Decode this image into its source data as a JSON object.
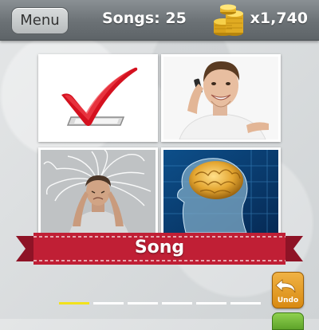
{
  "header": {
    "menu_label": "Menu",
    "songs_label": "Songs:  25",
    "coins_value": "x1,740",
    "coins_icon": "gold-coins-icon"
  },
  "puzzle": {
    "tiles": [
      {
        "name": "checkmark-picture"
      },
      {
        "name": "man-on-phone-picture"
      },
      {
        "name": "stressed-man-picture"
      },
      {
        "name": "brain-picture"
      }
    ],
    "banner_label": "Song"
  },
  "answer": {
    "slot_count": 6,
    "filled_slots": 1
  },
  "controls": {
    "undo_label": "Undo",
    "undo_icon": "undo-arrow-icon"
  },
  "colors": {
    "topbar": "#6b7175",
    "banner": "#c01f35",
    "slot_filled": "#f2e21c",
    "slot_empty": "#ffffff",
    "undo": "#e09a22"
  }
}
